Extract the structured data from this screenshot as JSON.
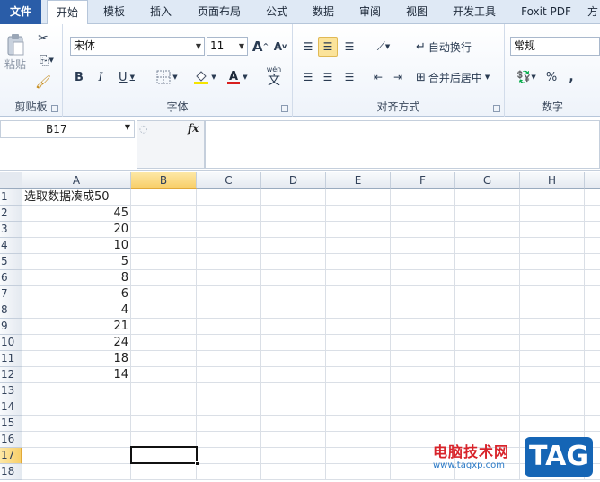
{
  "ribbon_tabs": [
    "文件",
    "开始",
    "模板",
    "插入",
    "页面布局",
    "公式",
    "数据",
    "审阅",
    "视图",
    "开发工具",
    "Foxit PDF",
    "方"
  ],
  "active_tab": "开始",
  "clipboard": {
    "paste_label": "粘贴",
    "group_label": "剪贴板"
  },
  "font": {
    "name": "宋体",
    "size": "11",
    "group_label": "字体",
    "bold": "B",
    "italic": "I",
    "underline": "U",
    "wen": "wén",
    "grow": "A",
    "shrink": "A"
  },
  "alignment": {
    "wrap_label": "自动换行",
    "merge_label": "合并后居中",
    "group_label": "对齐方式"
  },
  "number": {
    "format": "常规",
    "percent": "%",
    "comma": ",",
    "group_label": "数字"
  },
  "formula_bar": {
    "name_box": "B17",
    "fx": "fx",
    "formula": ""
  },
  "columns": [
    "A",
    "B",
    "C",
    "D",
    "E",
    "F",
    "G",
    "H"
  ],
  "selected_column": "B",
  "rows": [
    "1",
    "2",
    "3",
    "4",
    "5",
    "6",
    "7",
    "8",
    "9",
    "10",
    "11",
    "12",
    "13",
    "14",
    "15",
    "16",
    "17",
    "18"
  ],
  "selected_row": "17",
  "cells_a": [
    "选取数据凑成50",
    "45",
    "20",
    "10",
    "5",
    "8",
    "6",
    "4",
    "21",
    "24",
    "18",
    "14"
  ],
  "watermark": {
    "cn": "电脑技术网",
    "url": "www.tagxp.com",
    "tag": "TAG"
  },
  "colors": {
    "accent": "#2a5da8",
    "selection": "#f8cf6a",
    "watermark_red": "#d8232a",
    "watermark_blue": "#1565b5"
  }
}
